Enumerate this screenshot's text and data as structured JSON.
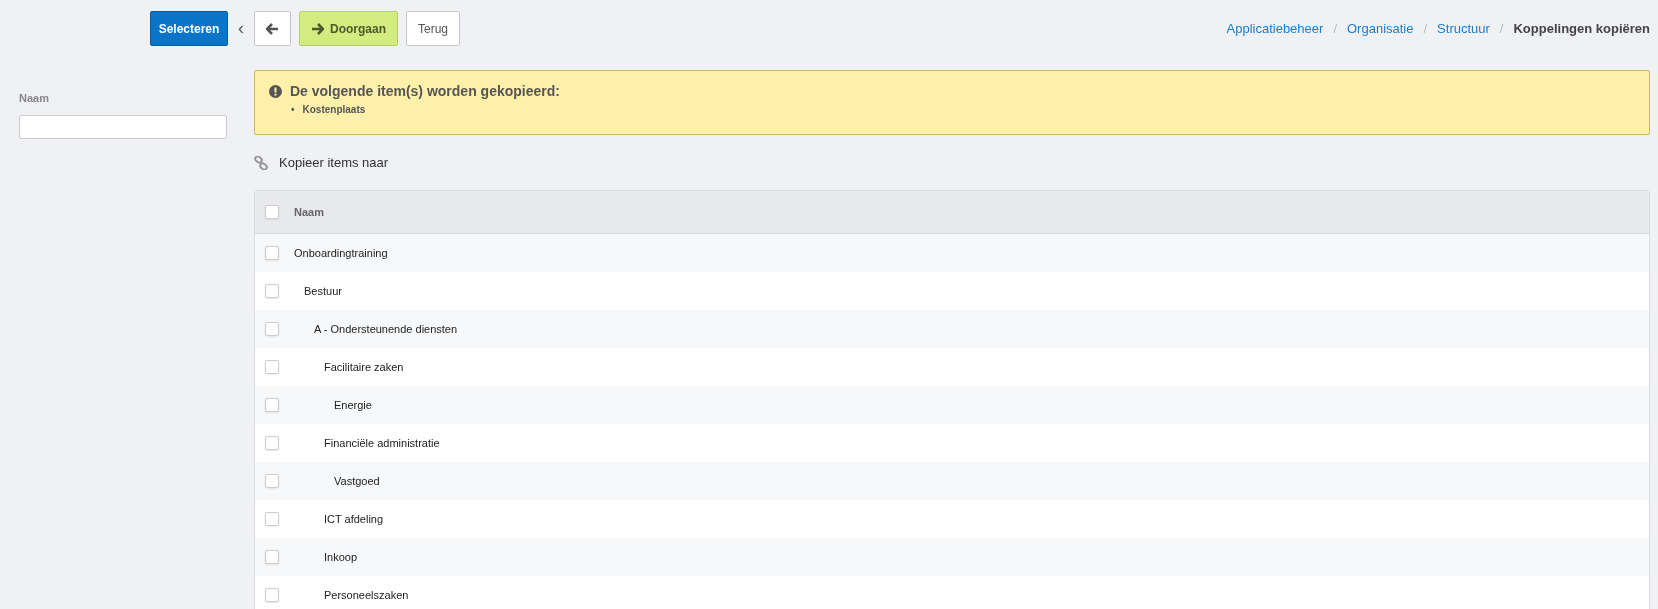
{
  "toolbar": {
    "select_button": "Selecteren",
    "collapse_toggle": "‹",
    "continue_button": "Doorgaan",
    "back_button": "Terug"
  },
  "breadcrumb": [
    {
      "label": "Applicatiebeheer",
      "current": false
    },
    {
      "label": "Organisatie",
      "current": false
    },
    {
      "label": "Structuur",
      "current": false
    },
    {
      "label": "Koppelingen kopiëren",
      "current": true
    }
  ],
  "breadcrumb_separator": "/",
  "sidebar": {
    "filter_label": "Naam"
  },
  "alert": {
    "title": "De volgende item(s) worden gekopieerd:",
    "bullet": "•",
    "items": [
      "Kostenplaats"
    ]
  },
  "section_title": "Kopieer items naar",
  "table": {
    "header": {
      "label": "Naam",
      "checked": false
    },
    "rows": [
      {
        "name": "Onboardingtraining",
        "checked": false,
        "children": [
          {
            "name": "Bestuur",
            "checked": false,
            "children": [
              {
                "name": "A - Ondersteunende diensten",
                "checked": false,
                "children": [
                  {
                    "name": "Facilitaire zaken",
                    "checked": false,
                    "children": [
                      {
                        "name": "Energie",
                        "checked": false
                      }
                    ]
                  },
                  {
                    "name": "Financiële administratie",
                    "checked": false,
                    "children": [
                      {
                        "name": "Vastgoed",
                        "checked": false
                      }
                    ]
                  },
                  {
                    "name": "ICT afdeling",
                    "checked": false
                  },
                  {
                    "name": "Inkoop",
                    "checked": false
                  },
                  {
                    "name": "Personeelszaken",
                    "checked": false
                  }
                ]
              }
            ]
          }
        ]
      }
    ]
  }
}
